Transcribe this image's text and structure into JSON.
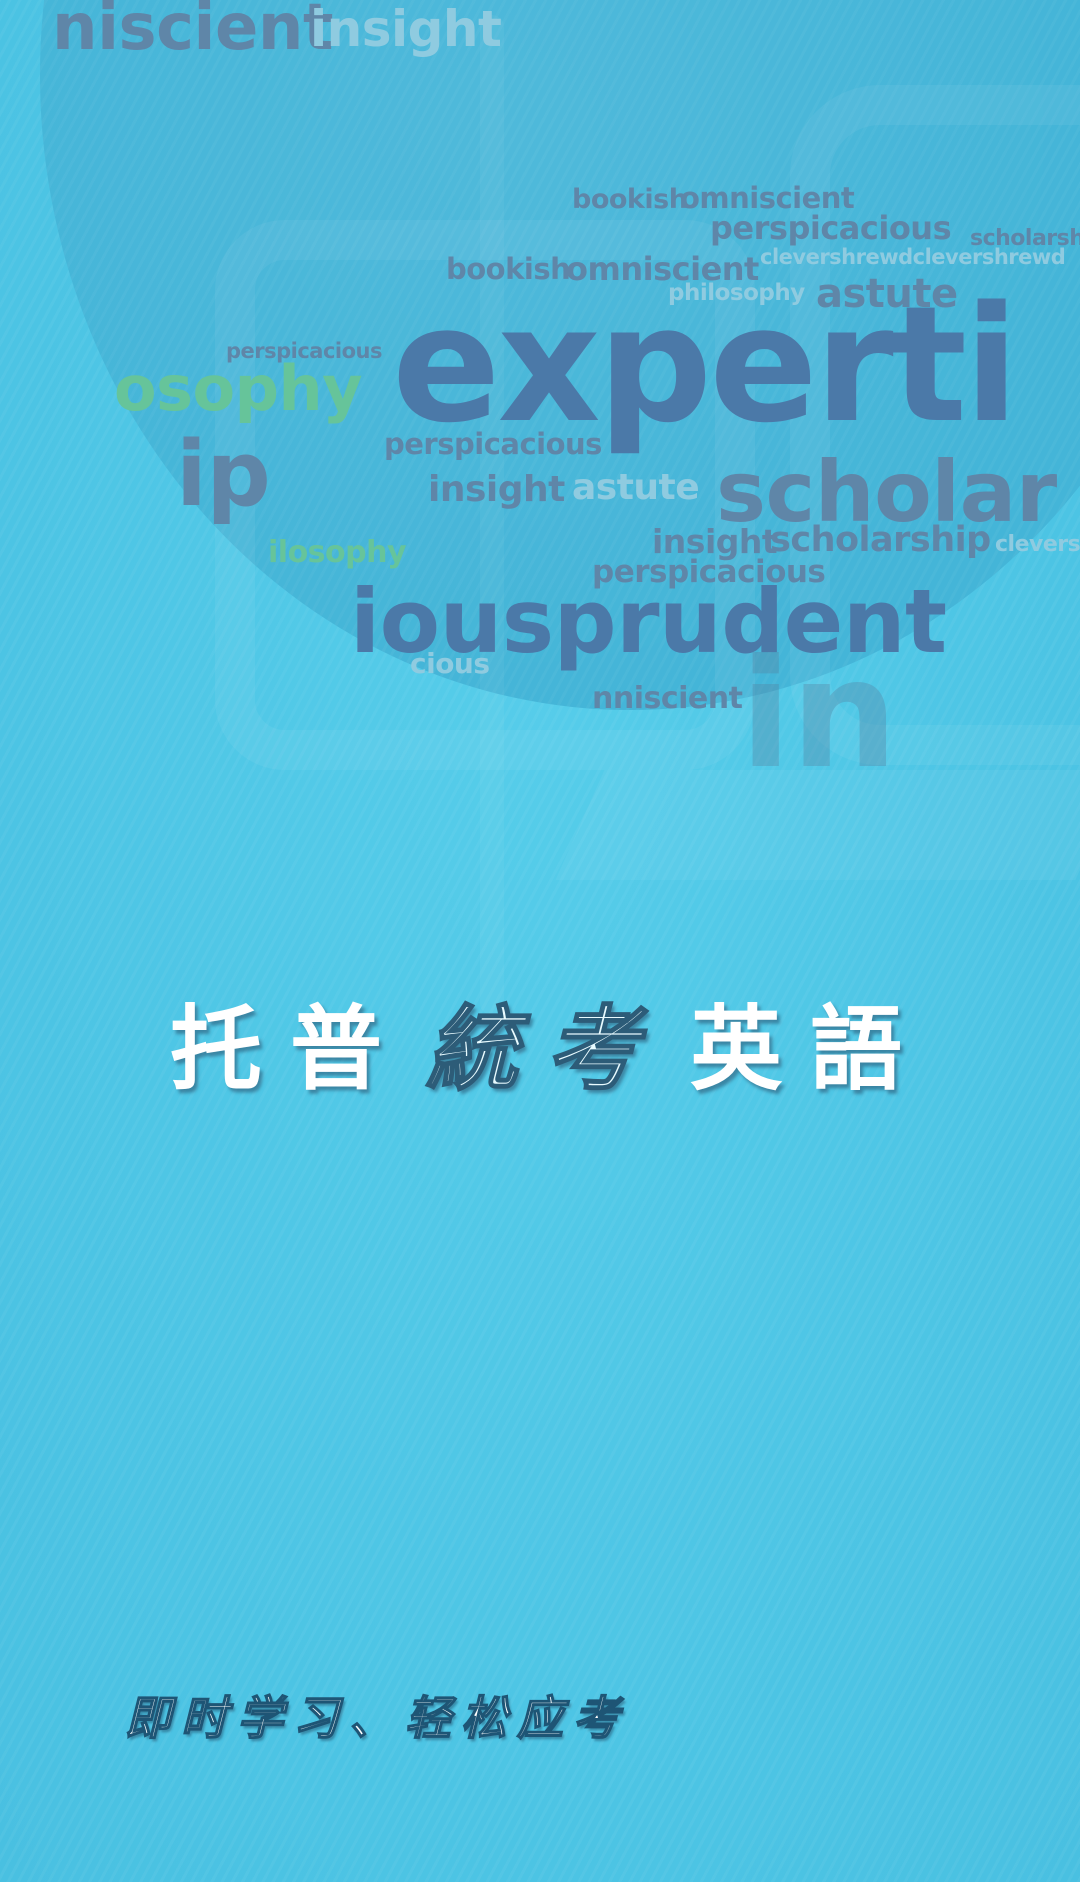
{
  "theme": {
    "background": "#4fc7e6",
    "circle": "#44b5d8",
    "word_primary": "#4b79a8",
    "word_accent": "#66c49a",
    "title_color": "#ffffff"
  },
  "wordcloud": {
    "w01": "niscient",
    "w02": "insight",
    "w03": "bookish",
    "w04": "omniscient",
    "w05": "perspicacious",
    "w06": "scholarsh",
    "w07": "bookish",
    "w08": "omniscient",
    "w09": "clevershrewdclevershrewd",
    "w10": "philosophy",
    "w11": "astute",
    "w12": "perspicacious",
    "w13": "osophy",
    "w14": "experti",
    "w15": "perspicacious",
    "w16": "ip",
    "w17": "insight",
    "w18": "astute",
    "w19": "scholar",
    "w20": "ilosophy",
    "w21": "insight",
    "w22": "scholarship",
    "w23": "clevers",
    "w24": "perspicacious",
    "w25": "iousprudent",
    "w26": "cious",
    "w27": "nniscient",
    "w28": "in"
  },
  "title": {
    "chars": [
      "托",
      "普",
      "統",
      "考",
      "英",
      "語"
    ]
  },
  "slogan": "即时学习、轻松应考"
}
